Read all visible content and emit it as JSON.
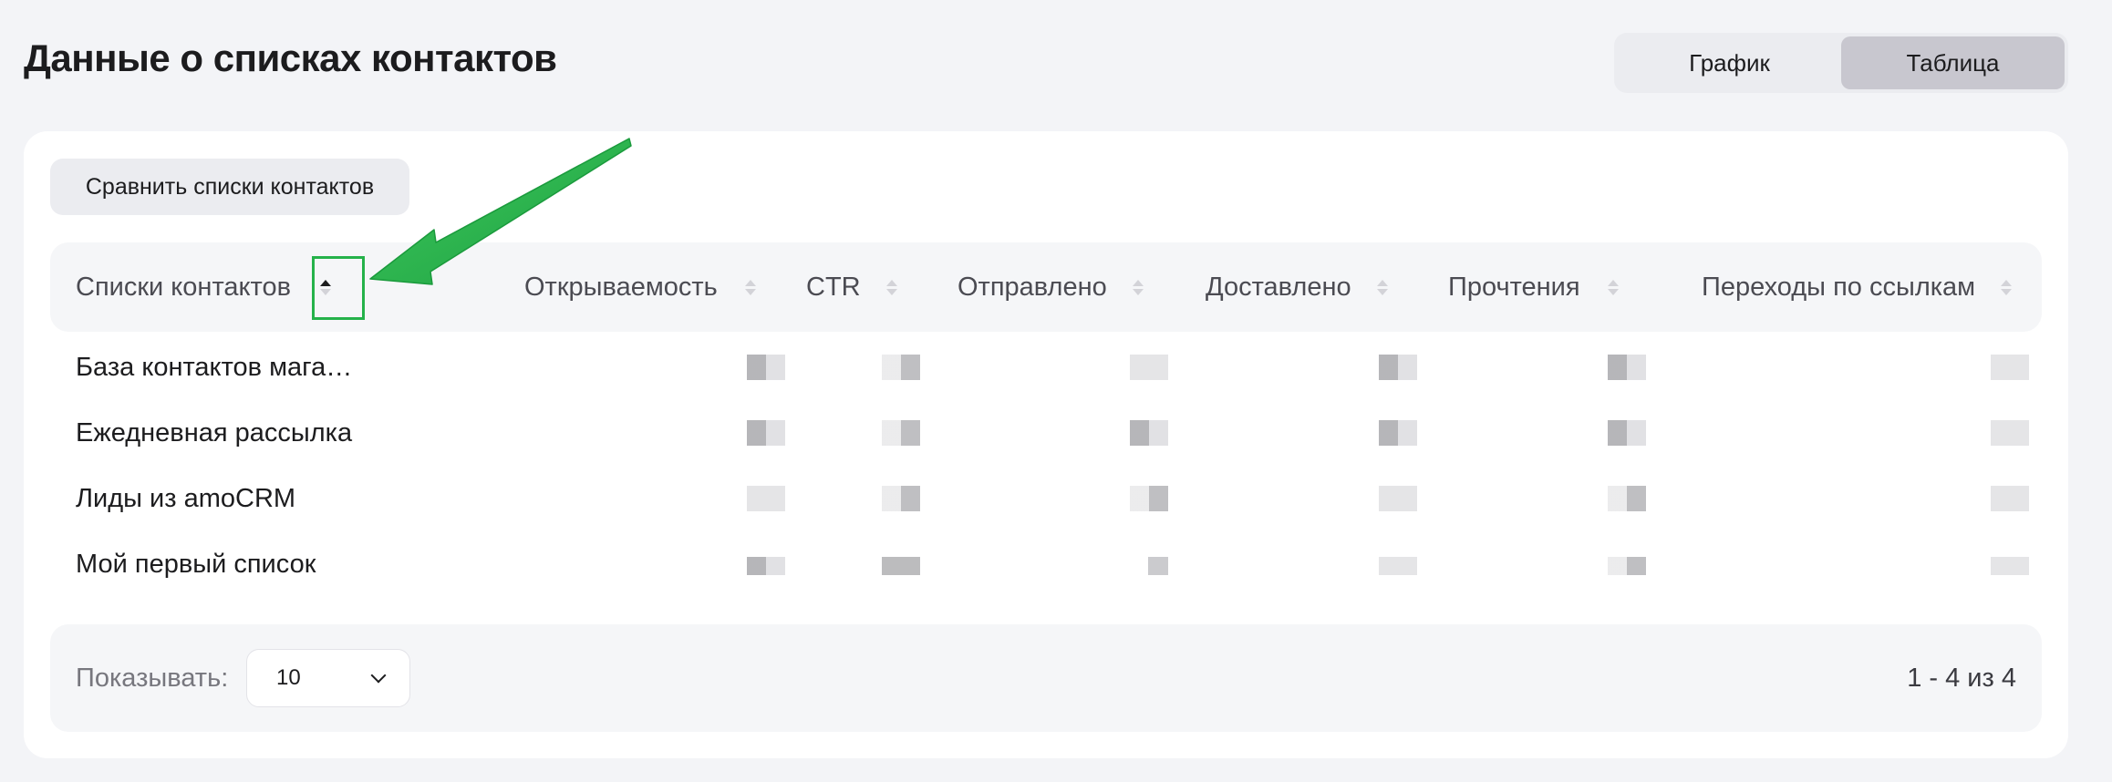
{
  "page": {
    "title": "Данные о списках контактов"
  },
  "view_toggle": {
    "chart_label": "График",
    "table_label": "Таблица",
    "active": "table"
  },
  "toolbar": {
    "compare_label": "Сравнить списки контактов"
  },
  "table": {
    "columns": [
      "Списки контактов",
      "Открываемость",
      "CTR",
      "Отправлено",
      "Доставлено",
      "Прочтения",
      "Переходы по ссылкам"
    ],
    "rows": [
      {
        "name": "База контактов мага…"
      },
      {
        "name": "Ежедневная рассылка"
      },
      {
        "name": "Лиды из amoCRM"
      },
      {
        "name": "Мой первый список"
      }
    ]
  },
  "pagination": {
    "show_label": "Показывать:",
    "page_size": "10",
    "range": "1 - 4 из 4"
  },
  "colors": {
    "highlight": "#25b24a",
    "accent_active": "#c8c7cf"
  },
  "icons": {
    "sort": "sort-arrows-icon",
    "dropdown": "chevron-down-icon",
    "annotation": "green-arrow-icon"
  }
}
